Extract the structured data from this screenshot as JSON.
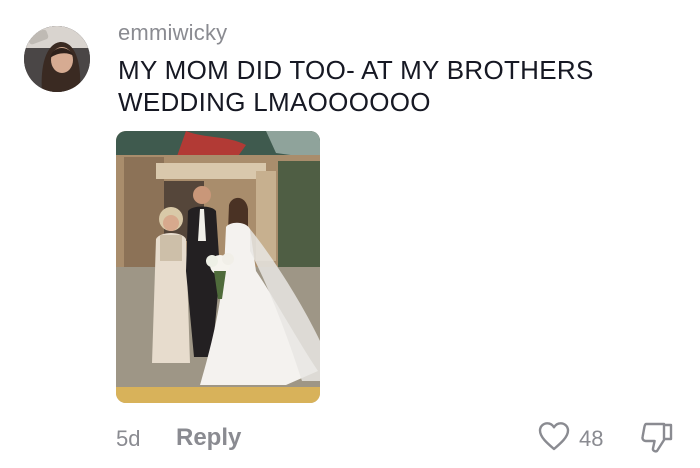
{
  "comment": {
    "username": "emmiwicky",
    "text": "MY MOM DID TOO- AT MY BROTHERS WEDDING LMAOOOOOO",
    "time": "5d",
    "reply_label": "Reply",
    "like_count": "48"
  },
  "icons": {
    "like": "heart-outline-icon",
    "dislike": "thumbs-down-outline-icon"
  },
  "colors": {
    "text_primary": "#161823",
    "text_secondary": "#8a8b91"
  }
}
